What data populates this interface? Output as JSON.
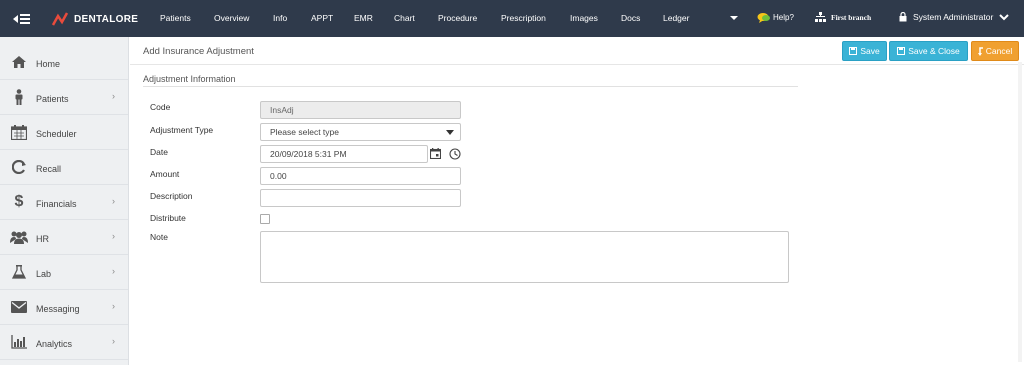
{
  "app": {
    "brand": "DENTALORE",
    "colors": {
      "topbar": "#2f3a4b",
      "accent": "#3ab3d6",
      "cancel": "#f0a030",
      "logo": "#e94b3c"
    }
  },
  "topnav": {
    "items": [
      "Patients",
      "Overview",
      "Info",
      "APPT",
      "EMR",
      "Chart",
      "Procedure",
      "Prescription",
      "Images",
      "Docs",
      "Ledger"
    ],
    "help": "Help?",
    "branch": "First branch",
    "user": "System Administrator"
  },
  "sidebar": {
    "items": [
      {
        "label": "Home",
        "icon": "home-icon",
        "has_children": false
      },
      {
        "label": "Patients",
        "icon": "person-icon",
        "has_children": true
      },
      {
        "label": "Scheduler",
        "icon": "calendar-icon",
        "has_children": false
      },
      {
        "label": "Recall",
        "icon": "recall-icon",
        "has_children": false
      },
      {
        "label": "Financials",
        "icon": "dollar-icon",
        "has_children": true
      },
      {
        "label": "HR",
        "icon": "group-icon",
        "has_children": true
      },
      {
        "label": "Lab",
        "icon": "flask-icon",
        "has_children": true
      },
      {
        "label": "Messaging",
        "icon": "envelope-icon",
        "has_children": true
      },
      {
        "label": "Analytics",
        "icon": "bar-chart-icon",
        "has_children": true
      }
    ]
  },
  "page": {
    "title": "Add Insurance Adjustment",
    "save": "Save",
    "save_close": "Save & Close",
    "cancel": "Cancel",
    "section": "Adjustment Information"
  },
  "form": {
    "code_label": "Code",
    "code_value": "InsAdj",
    "type_label": "Adjustment Type",
    "type_value": "Please select type",
    "date_label": "Date",
    "date_value": "20/09/2018 5:31 PM",
    "amount_label": "Amount",
    "amount_value": "0.00",
    "description_label": "Description",
    "description_value": "",
    "distribute_label": "Distribute",
    "distribute_checked": false,
    "note_label": "Note",
    "note_value": ""
  }
}
